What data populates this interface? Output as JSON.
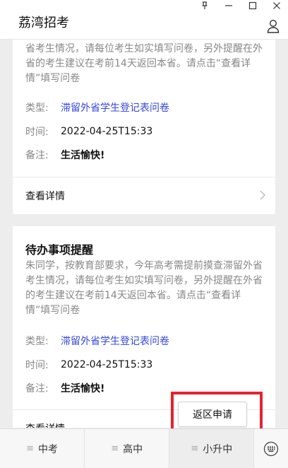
{
  "app": {
    "title": "荔湾招考"
  },
  "window": {
    "pin": "⊥",
    "minimize": "—",
    "maximize": "□",
    "close": "✕"
  },
  "cards": [
    {
      "body": "省考生情况，请每位考生如实填写问卷，另外提醒在外省的考生建议在考前14天返回本省。请点击“查看详情”填写问卷",
      "type_label": "类型:",
      "type_value": "滞留外省学生登记表问卷",
      "time_label": "时间:",
      "time_value": "2022-04-25T15:33",
      "note_label": "备注:",
      "note_value": "生活愉快!",
      "detail_label": "查看详情"
    },
    {
      "title": "待办事项提醒",
      "body": "朱同学，按教育部要求，今年高考需提前摸查滞留外省考生情况，请每位考生如实填写问卷，另外提醒在外省的考生建议在考前14天返回本省。请点击“查看详情”填写问卷",
      "type_label": "类型:",
      "type_value": "滞留外省学生登记表问卷",
      "time_label": "时间:",
      "time_value": "2022-04-25T15:33",
      "note_label": "备注:",
      "note_value": "生活愉快!",
      "detail_label": "查看详情"
    }
  ],
  "floating_button": {
    "label": "返区申请"
  },
  "tabs": [
    {
      "label": "中考"
    },
    {
      "label": "高中"
    },
    {
      "label": "小升中"
    }
  ],
  "colors": {
    "link": "#3447d8",
    "highlight": "#e52330"
  }
}
